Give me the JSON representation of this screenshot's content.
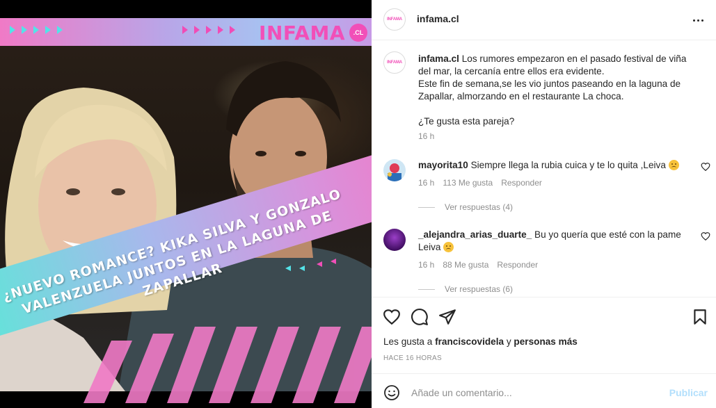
{
  "post": {
    "banner_logo": "INFAMA",
    "banner_logo_suffix": ".CL",
    "headline_line1": "¿NUEVO ROMANCE? KIKA SILVA Y GONZALO",
    "headline_line2": "VALENZUELA JUNTOS EN LA LAGUNA DE ZAPALLAR"
  },
  "header": {
    "avatar_text": "INFAMA",
    "username": "infama.cl"
  },
  "caption": {
    "avatar_text": "INFAMA",
    "username": "infama.cl",
    "text_1": "Los rumores empezaron en el pasado festival de viña del mar, la cercanía entre ellos era evidente.",
    "text_2": "Este fin de semana,se les vio juntos paseando en la laguna de Zapallar, almorzando en el restaurante La choca.",
    "text_3": "¿Te gusta esta pareja?",
    "time": "16 h"
  },
  "comments": [
    {
      "username": "mayorita10",
      "text": "Siempre llega la rubia cuica y te lo quita ,Leiva",
      "time": "16 h",
      "likes": "113 Me gusta",
      "reply": "Responder",
      "view_replies": "Ver respuestas (4)"
    },
    {
      "username": "_alejandra_arias_duarte_",
      "text": "Bu yo quería que esté con la pame Leiva",
      "time": "16 h",
      "likes": "88 Me gusta",
      "reply": "Responder",
      "view_replies": "Ver respuestas (6)"
    }
  ],
  "likes": {
    "prefix": "Les gusta a",
    "user": "franciscovidela",
    "conj": "y",
    "others": "personas más"
  },
  "post_time": "HACE 16 HORAS",
  "add_comment": {
    "placeholder": "Añade un comentario...",
    "publish": "Publicar"
  },
  "colors": {
    "brand_pink": "#f14fb8",
    "accent_cyan": "#54e3e8",
    "link_disabled": "#b2dffc"
  }
}
